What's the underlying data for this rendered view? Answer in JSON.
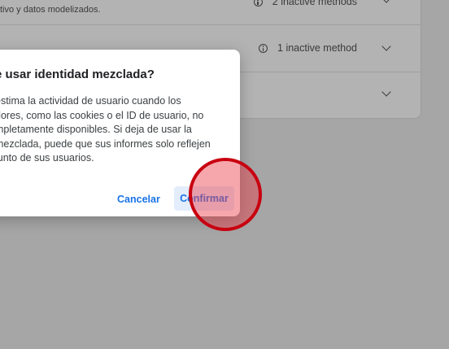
{
  "background": {
    "rows": [
      {
        "subtitle": "tivo y datos modelizados.",
        "inactive_label": "2 inactive methods"
      },
      {
        "subtitle": "",
        "inactive_label": "1 inactive method"
      },
      {
        "subtitle": "",
        "inactive_label": ""
      }
    ]
  },
  "dialog": {
    "title": "e usar identidad mezclada?",
    "body_lines": [
      "estima la actividad de usuario cuando los",
      "dores, como las cookies o el ID de usuario, no",
      "mpletamente disponibles. Si deja de usar la",
      "mezclada, puede que sus informes solo reflejen",
      "junto de sus usuarios."
    ],
    "cancel_label": "Cancelar",
    "confirm_label": "Confirmar"
  },
  "colors": {
    "accent": "#1a73e8",
    "click_indicator": "#c8000f",
    "overlay": "#a6a6a6"
  }
}
